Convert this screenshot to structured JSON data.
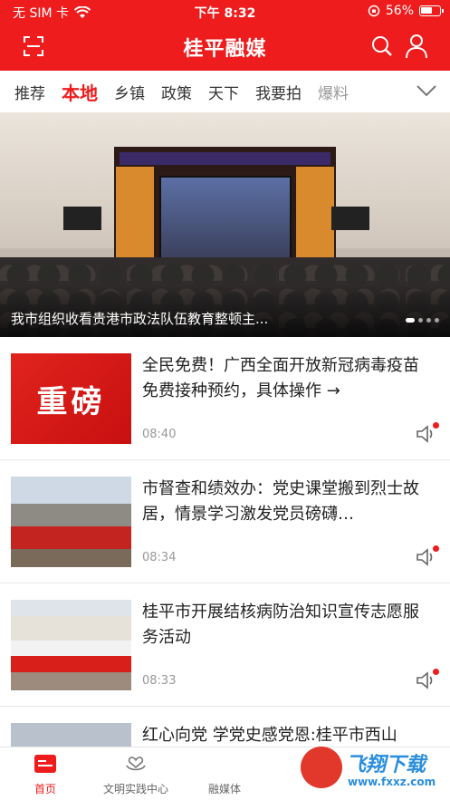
{
  "status_bar": {
    "carrier": "无 SIM 卡",
    "time": "下午 8:32",
    "battery": "56%"
  },
  "header": {
    "title": "桂平融媒",
    "scan_icon": "scan-icon",
    "search_icon": "search-icon",
    "user_icon": "user-icon"
  },
  "tabs": [
    {
      "label": "推荐"
    },
    {
      "label": "本地"
    },
    {
      "label": "乡镇"
    },
    {
      "label": "政策"
    },
    {
      "label": "天下"
    },
    {
      "label": "我要拍"
    },
    {
      "label": "爆料"
    }
  ],
  "active_tab": "本地",
  "hero": {
    "caption": "我市组织收看贵港市政法队伍教育整顿主..."
  },
  "news": [
    {
      "headline": "全民免费！广西全面开放新冠病毒疫苗免费接种预约，具体操作 →",
      "time": "08:40",
      "thumb_text": "重磅"
    },
    {
      "headline": "市督查和绩效办：党史课堂搬到烈士故居，情景学习激发党员磅礴…",
      "time": "08:34"
    },
    {
      "headline": "桂平市开展结核病防治知识宣传志愿服务活动",
      "time": "08:33"
    },
    {
      "headline": "红心向党 学党史感党恩:桂平市西山",
      "time": ""
    }
  ],
  "tabbar": [
    {
      "label": "首页"
    },
    {
      "label": "文明实践中心"
    },
    {
      "label": "融媒体"
    }
  ],
  "watermark": {
    "brand": "飞翔下载",
    "url": "www.fxxz.com"
  },
  "colors": {
    "brand_red": "#ee1c1c"
  }
}
